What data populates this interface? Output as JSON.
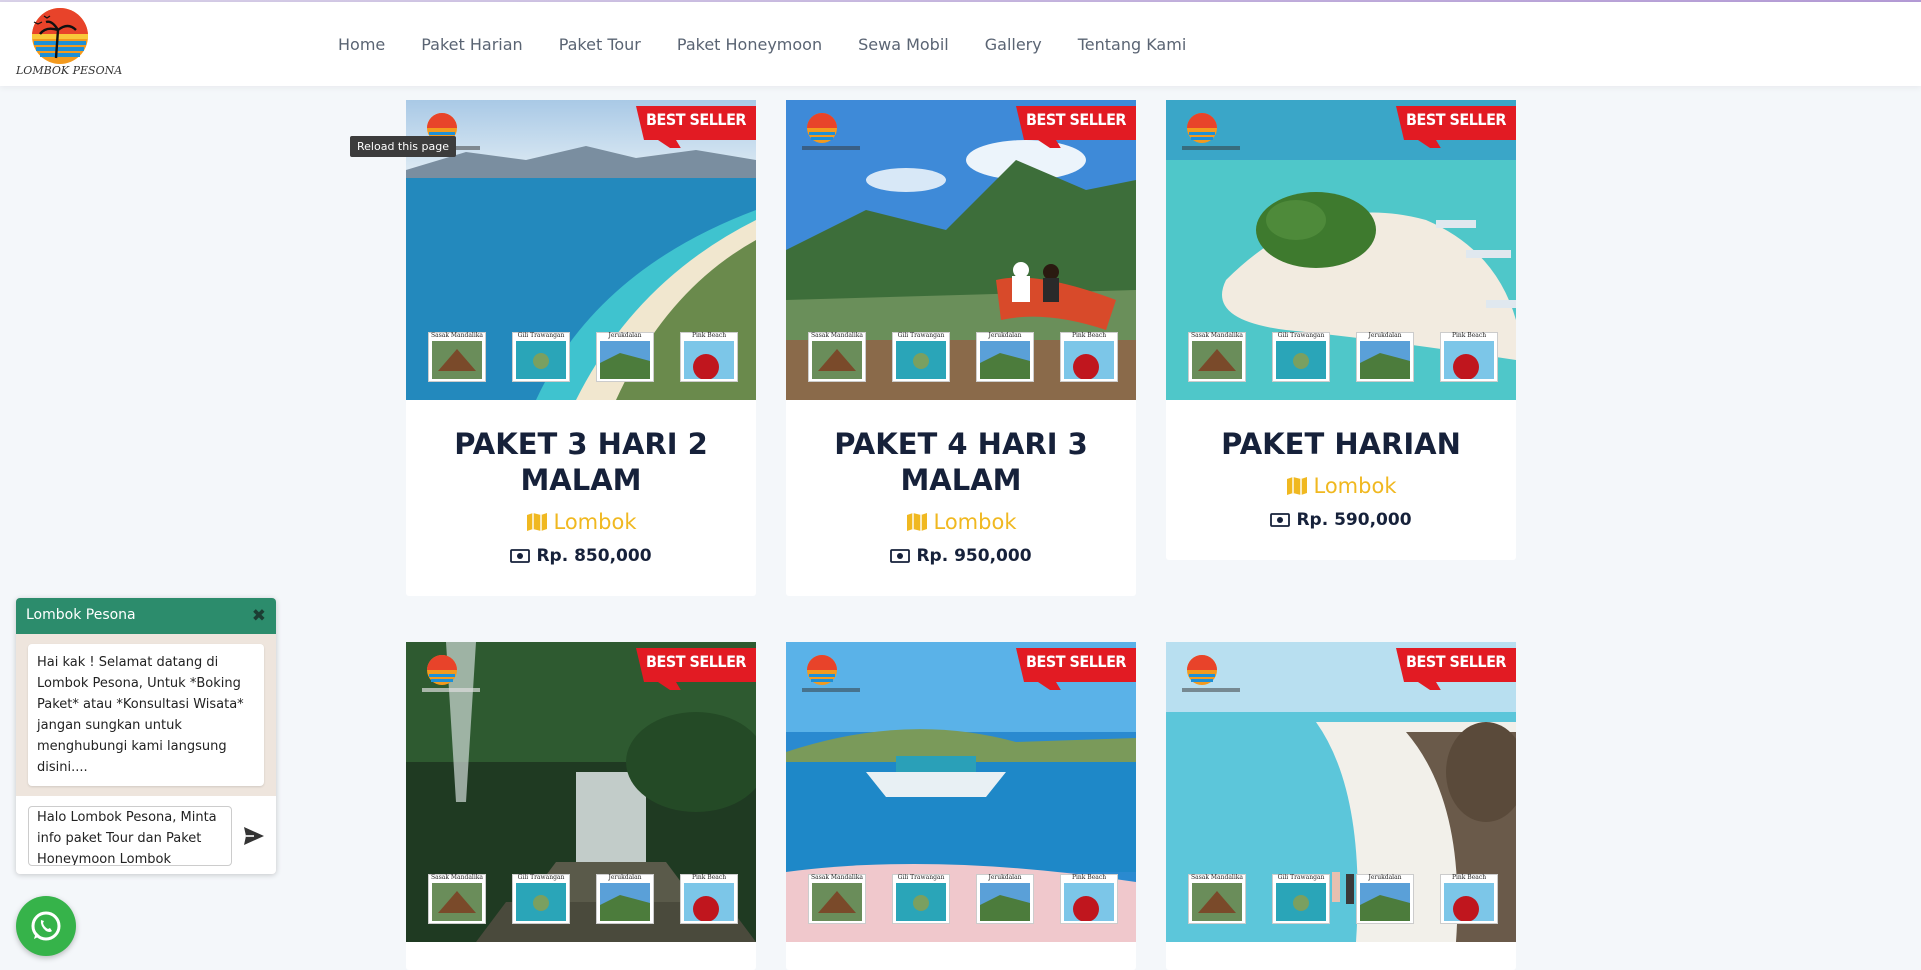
{
  "site": {
    "logo_text": "LOMBOK PESONA"
  },
  "nav": {
    "items": [
      "Home",
      "Paket Harian",
      "Paket Tour",
      "Paket Honeymoon",
      "Sewa Mobil",
      "Gallery",
      "Tentang Kami"
    ]
  },
  "tooltip": {
    "text": "Reload this page"
  },
  "badge_text": "BEST SELLER",
  "thumb_captions": [
    "Sasak Mandalika",
    "Gili Trawangan",
    "Jerukdalan",
    "Pink Beach"
  ],
  "cards": [
    {
      "title": "PAKET 3 HARI 2 MALAM",
      "location": "Lombok",
      "price": "Rp. 850,000"
    },
    {
      "title": "PAKET 4 HARI 3 MALAM",
      "location": "Lombok",
      "price": "Rp. 950,000"
    },
    {
      "title": "PAKET HARIAN",
      "location": "Lombok",
      "price": "Rp. 590,000"
    },
    {
      "title": "",
      "location": "",
      "price": ""
    },
    {
      "title": "",
      "location": "",
      "price": ""
    },
    {
      "title": "",
      "location": "",
      "price": ""
    }
  ],
  "chat": {
    "header": "Lombok Pesona",
    "message": "Hai kak ! Selamat datang di Lombok Pesona, Untuk *Boking Paket* atau *Konsultasi Wisata* jangan sungkan untuk menghubungi kami langsung disini....",
    "input_value": "Halo Lombok Pesona, Minta info paket Tour dan Paket Honeymoon Lombok"
  },
  "colors": {
    "accent": "#f0b820",
    "title": "#16213a",
    "chat_header": "#2c8c6c",
    "whatsapp": "#36b34a",
    "badge": "#e21b23"
  },
  "icons": {
    "location": "map-icon",
    "price": "money-bill-icon",
    "send": "send-icon",
    "close": "close-icon",
    "whatsapp": "whatsapp-icon"
  }
}
